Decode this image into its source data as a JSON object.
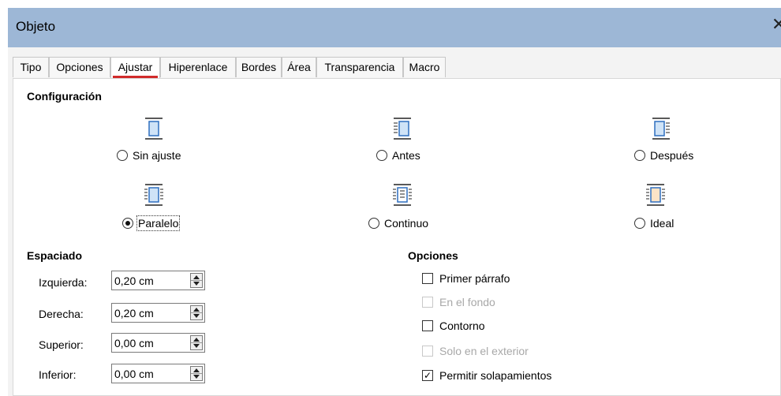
{
  "window": {
    "title": "Objeto",
    "close_icon": "close-icon"
  },
  "tabs": [
    {
      "label": "Tipo",
      "active": false
    },
    {
      "label": "Opciones",
      "active": false
    },
    {
      "label": "Ajustar",
      "active": true
    },
    {
      "label": "Hiperenlace",
      "active": false
    },
    {
      "label": "Bordes",
      "active": false
    },
    {
      "label": "Área",
      "active": false
    },
    {
      "label": "Transparencia",
      "active": false
    },
    {
      "label": "Macro",
      "active": false
    }
  ],
  "settings": {
    "heading": "Configuración",
    "options": [
      {
        "id": "sin-ajuste",
        "label": "Sin ajuste",
        "selected": false,
        "icon": "wrap-none-icon"
      },
      {
        "id": "antes",
        "label": "Antes",
        "selected": false,
        "icon": "wrap-before-icon"
      },
      {
        "id": "despues",
        "label": "Después",
        "selected": false,
        "icon": "wrap-after-icon"
      },
      {
        "id": "paralelo",
        "label": "Paralelo",
        "selected": true,
        "icon": "wrap-parallel-icon"
      },
      {
        "id": "continuo",
        "label": "Continuo",
        "selected": false,
        "icon": "wrap-through-icon"
      },
      {
        "id": "ideal",
        "label": "Ideal",
        "selected": false,
        "icon": "wrap-optimal-icon"
      }
    ]
  },
  "spacing": {
    "heading": "Espaciado",
    "fields": [
      {
        "label": "Izquierda:",
        "value": "0,20 cm"
      },
      {
        "label": "Derecha:",
        "value": "0,20 cm"
      },
      {
        "label": "Superior:",
        "value": "0,00 cm"
      },
      {
        "label": "Inferior:",
        "value": "0,00 cm"
      }
    ]
  },
  "options": {
    "heading": "Opciones",
    "items": [
      {
        "label": "Primer párrafo",
        "checked": false,
        "enabled": true
      },
      {
        "label": "En el fondo",
        "checked": false,
        "enabled": false
      },
      {
        "label": "Contorno",
        "checked": false,
        "enabled": true
      },
      {
        "label": "Solo en el exterior",
        "checked": false,
        "enabled": false
      },
      {
        "label": "Permitir solapamientos",
        "checked": true,
        "enabled": true
      }
    ]
  },
  "colors": {
    "titlebar": "#9db7d6",
    "tab_underline": "#d12b2b",
    "icon_blue": "#2f6fbf",
    "icon_fill": "#cfe3f7",
    "icon_orange_fill": "#fbe3c7"
  }
}
